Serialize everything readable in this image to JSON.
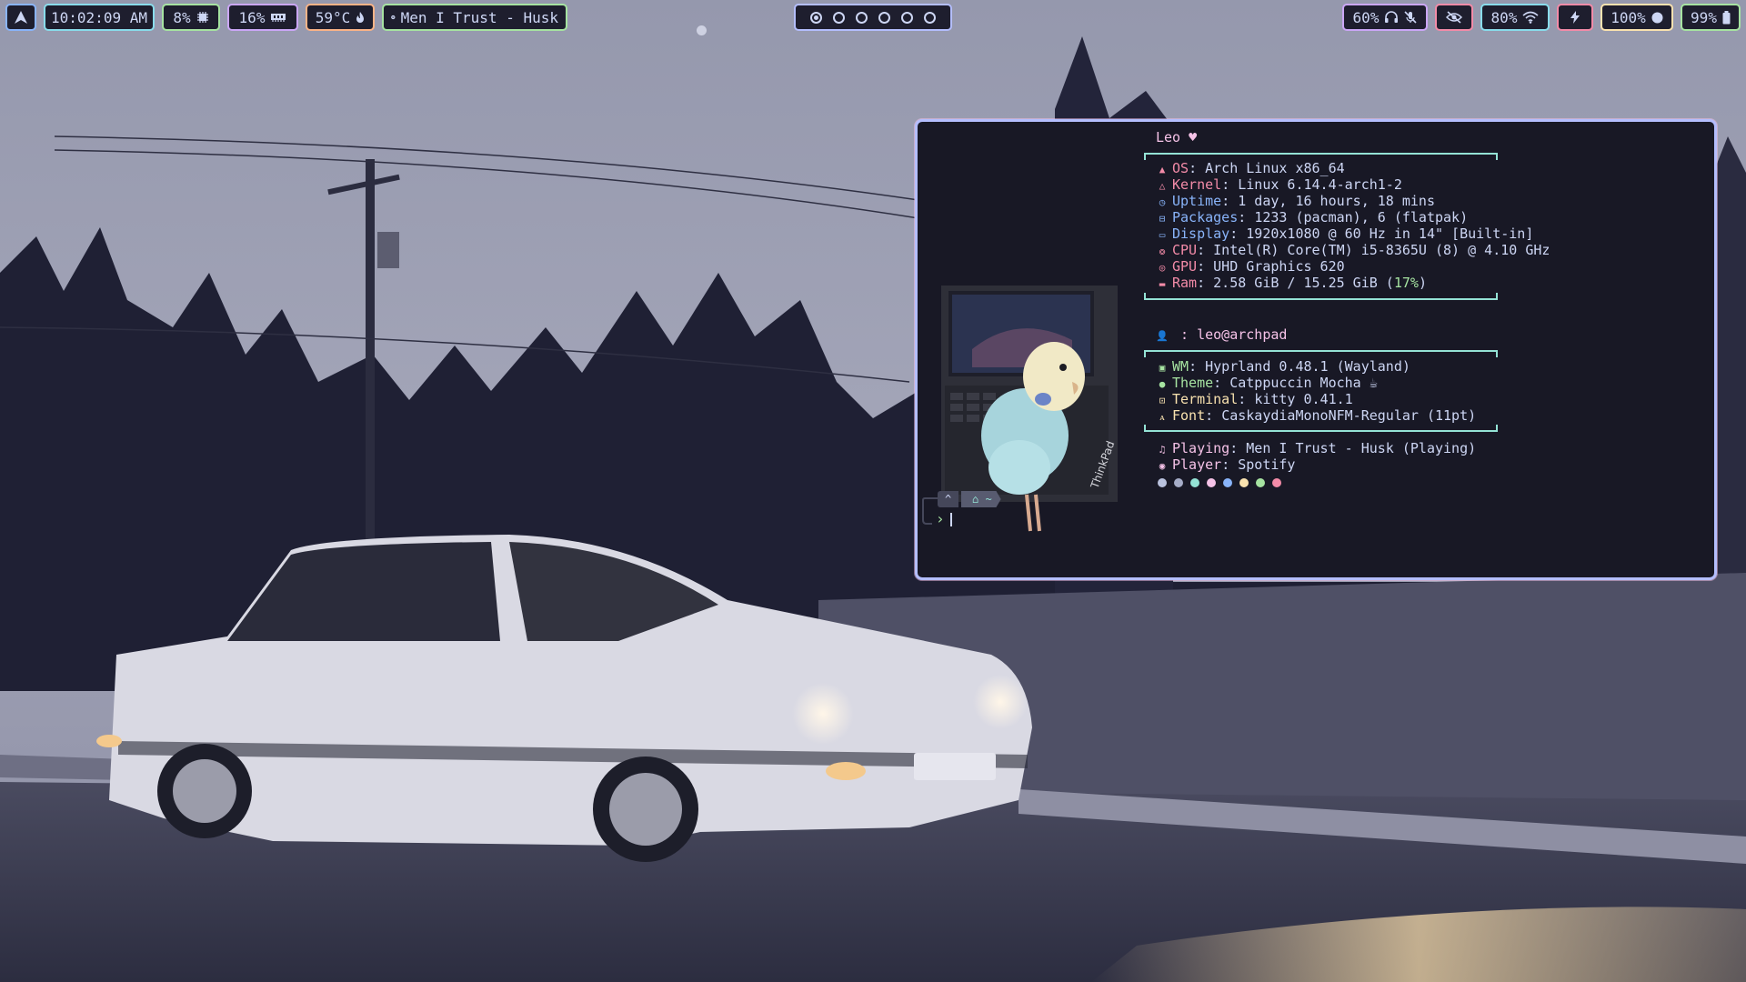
{
  "bar": {
    "launcher_icon": "arch-a-icon",
    "clock": "10:02:09 AM",
    "cpu": "8%",
    "memory": "16%",
    "temperature": "59°C",
    "media": "Men I Trust - Husk",
    "workspaces": {
      "count": 6,
      "active": 1
    },
    "volume": "60%",
    "wifi": "80%",
    "brightness": "100%",
    "battery": "99%",
    "colors": {
      "launcher": "#89b4fa",
      "clock": "#89dceb",
      "cpu": "#a6e3a1",
      "memory": "#cba6f7",
      "temperature": "#fab387",
      "media": "#a6e3a1",
      "workspaces": "#b4befe",
      "volume": "#cba6f7",
      "privacy": "#f38ba8",
      "wifi": "#89dceb",
      "power": "#f38ba8",
      "brightness": "#f9e2af",
      "battery": "#a6e3a1"
    }
  },
  "terminal": {
    "header": "Leo ♥",
    "system": [
      {
        "icon": "arch-icon",
        "key": "OS",
        "value": "Arch Linux x86_64"
      },
      {
        "icon": "kernel-icon",
        "key": "Kernel",
        "value": "Linux 6.14.4-arch1-2"
      },
      {
        "icon": "clock-icon",
        "key": "Uptime",
        "value": "1 day, 16 hours, 18 mins"
      },
      {
        "icon": "package-icon",
        "key": "Packages",
        "value": "1233 (pacman), 6 (flatpak)"
      },
      {
        "icon": "monitor-icon",
        "key": "Display",
        "value": "1920x1080 @ 60 Hz in 14\" [Built-in]"
      },
      {
        "icon": "cpu-icon",
        "key": "CPU",
        "value": "Intel(R) Core(TM) i5-8365U (8) @ 4.10 GHz"
      },
      {
        "icon": "gpu-icon",
        "key": "GPU",
        "value": "UHD Graphics 620"
      },
      {
        "icon": "ram-icon",
        "key": "Ram",
        "value": "2.58 GiB / 15.25 GiB (",
        "extra": "17%",
        "tail": ")"
      }
    ],
    "user_label": ": leo@archpad",
    "desktop": [
      {
        "icon": "window-icon",
        "key": "WM",
        "value": "Hyprland 0.48.1 (Wayland)"
      },
      {
        "icon": "palette-icon",
        "key": "Theme",
        "value": "Catppuccin Mocha ☕"
      },
      {
        "icon": "terminal-icon",
        "key": "Terminal",
        "value": "kitty 0.41.1"
      },
      {
        "icon": "font-icon",
        "key": "Font",
        "value": "CaskaydiaMonoNFM-Regular (11pt)"
      }
    ],
    "media": [
      {
        "icon": "music-icon",
        "key": "Playing",
        "value": "Men I Trust - Husk (Playing)"
      },
      {
        "icon": "spotify-icon",
        "key": "Player",
        "value": "Spotify"
      }
    ],
    "palette": [
      "#bac2de",
      "#a6adc8",
      "#94e2d5",
      "#f5c2e7",
      "#89b4fa",
      "#f9e2af",
      "#a6e3a1",
      "#f38ba8"
    ],
    "prompt_segments": [
      "^",
      "⌂ ~"
    ],
    "prompt_symbol": "›",
    "key_colors": {
      "OS": "#f38ba8",
      "Kernel": "#f38ba8",
      "Uptime": "#89b4fa",
      "Packages": "#89b4fa",
      "Display": "#89b4fa",
      "CPU": "#f38ba8",
      "GPU": "#f38ba8",
      "Ram": "#f38ba8",
      "WM": "#a6e3a1",
      "Theme": "#a6e3a1",
      "Terminal": "#f9e2af",
      "Font": "#f9e2af",
      "Playing": "#f5c2e7",
      "Player": "#f5c2e7"
    }
  }
}
